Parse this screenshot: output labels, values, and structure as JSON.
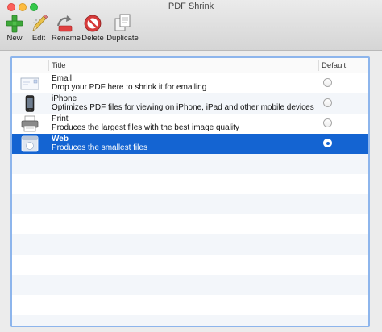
{
  "window": {
    "title": "PDF Shrink"
  },
  "toolbar": {
    "new_label": "New",
    "edit_label": "Edit",
    "rename_label": "Rename",
    "delete_label": "Delete",
    "duplicate_label": "Duplicate"
  },
  "table": {
    "headers": {
      "title": "Title",
      "default": "Default"
    },
    "rows": [
      {
        "name": "Email",
        "description": "Drop your PDF here to shrink it for emailing",
        "icon": "envelope-icon",
        "default": false,
        "selected": false
      },
      {
        "name": "iPhone",
        "description": "Optimizes PDF files for viewing on iPhone, iPad and other mobile devices",
        "icon": "iphone-icon",
        "default": false,
        "selected": false
      },
      {
        "name": "Print",
        "description": "Produces the largest files with the best image quality",
        "icon": "printer-icon",
        "default": false,
        "selected": false
      },
      {
        "name": "Web",
        "description": "Produces the smallest files",
        "icon": "web-icon",
        "default": true,
        "selected": true
      }
    ]
  },
  "colors": {
    "selection": "#1464d2",
    "frame_focus": "#8db5ec"
  }
}
